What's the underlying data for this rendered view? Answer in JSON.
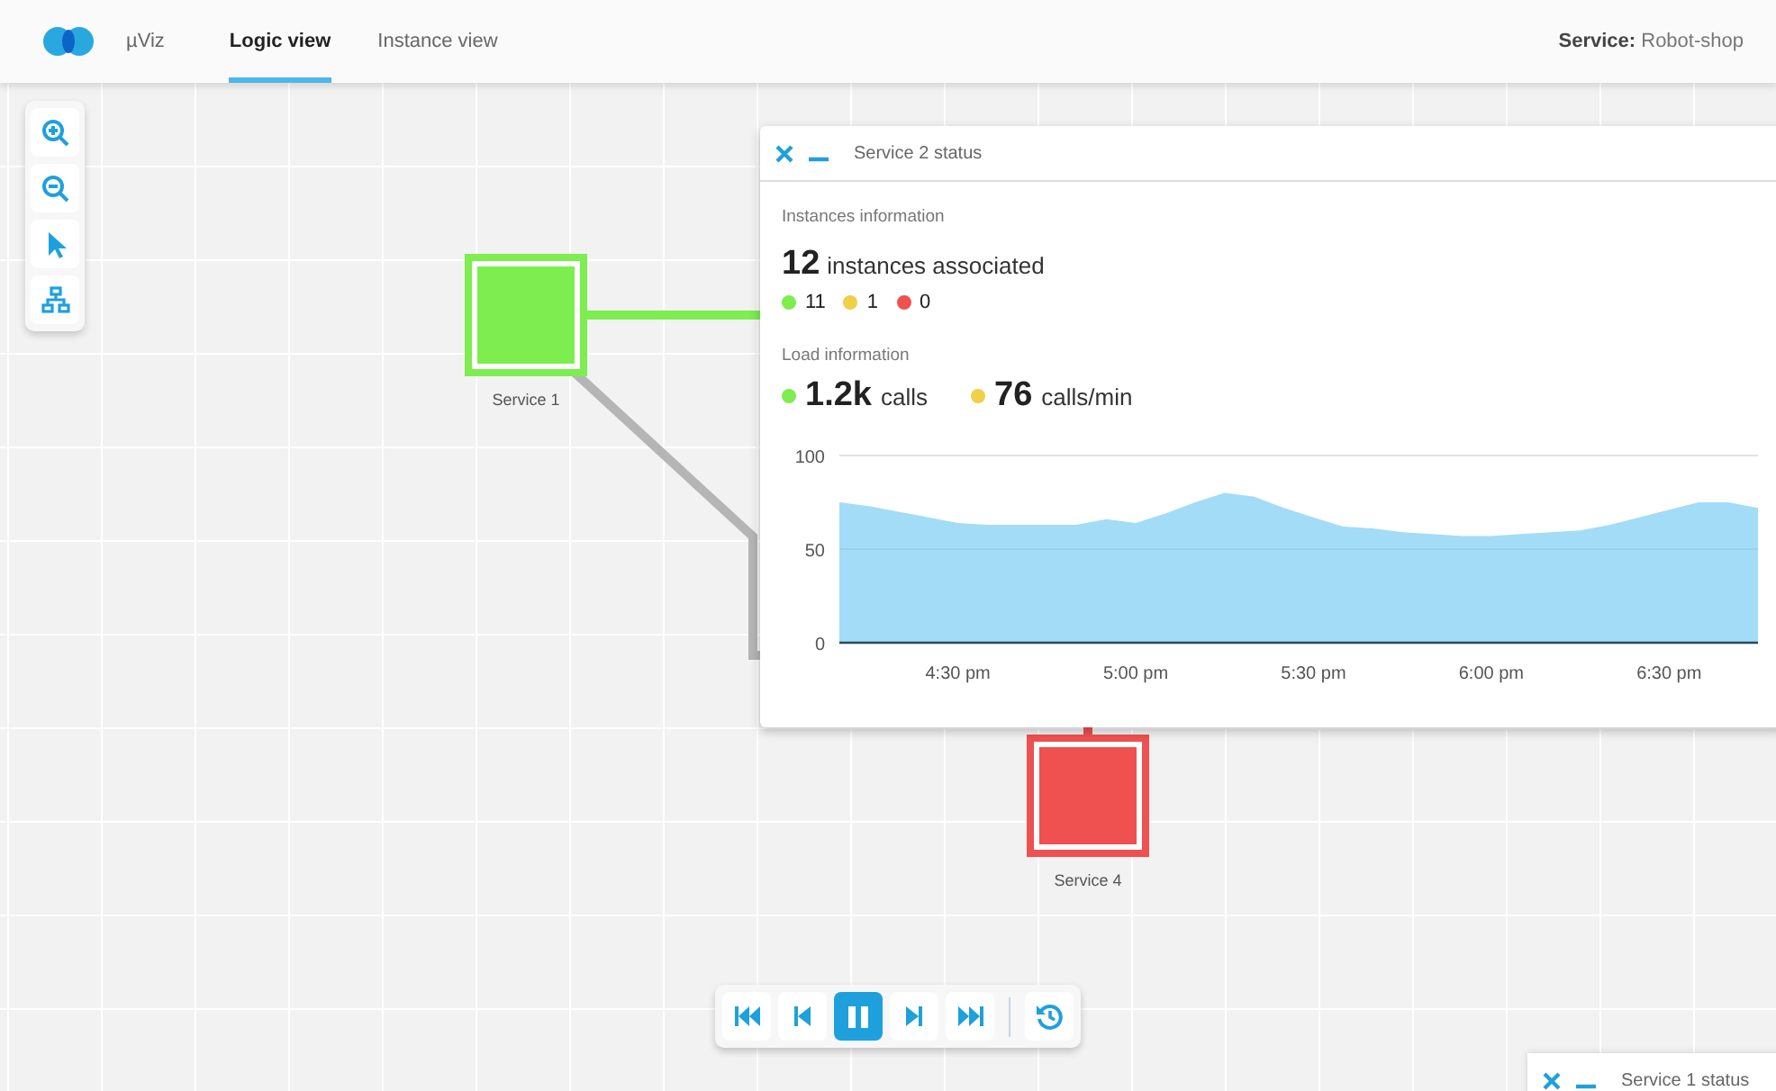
{
  "header": {
    "app_name": "µViz",
    "tabs": [
      {
        "label": "Logic view",
        "selected": true
      },
      {
        "label": "Instance view",
        "selected": false
      }
    ],
    "service_label": "Service:",
    "service_value": "Robot-shop"
  },
  "nodes": [
    {
      "name": "Service 1",
      "color": "#7ded4f"
    },
    {
      "name": "Service 4",
      "color": "#ef5050"
    }
  ],
  "status_panel": {
    "title": "Service 2 status",
    "instances_heading": "Instances information",
    "instances_count": "12",
    "instances_text": "instances associated",
    "instance_counts": [
      {
        "value": "11",
        "color": "#7ded4f"
      },
      {
        "value": "1",
        "color": "#f0cf4a"
      },
      {
        "value": "0",
        "color": "#ef5050"
      }
    ],
    "load_heading": "Load information",
    "load_stats": [
      {
        "value": "1.2k",
        "unit": "calls",
        "color": "#7ded4f"
      },
      {
        "value": "76",
        "unit": "calls/min",
        "color": "#f0cf4a"
      }
    ],
    "chart_data": {
      "type": "area",
      "categories": [
        null,
        null,
        null,
        null,
        "4:30 pm",
        null,
        null,
        null,
        null,
        null,
        "5:00 pm",
        null,
        null,
        null,
        null,
        null,
        "5:30 pm",
        null,
        null,
        null,
        null,
        null,
        "6:00 pm",
        null,
        null,
        null,
        null,
        null,
        "6:30 pm",
        null,
        null,
        null
      ],
      "series": [
        {
          "color": "#a3dcf6",
          "values": [
            75,
            73,
            70,
            67,
            64,
            63,
            63,
            63,
            63,
            66,
            64,
            69,
            75,
            80,
            78,
            72,
            67,
            62,
            61,
            59,
            58,
            57,
            57,
            58,
            59,
            60,
            63,
            67,
            71,
            75,
            75,
            72
          ]
        }
      ],
      "ylim": [
        0,
        100
      ],
      "yticks": [
        0,
        50,
        100
      ]
    }
  },
  "playback": {
    "buttons": [
      {
        "kind": "first",
        "selected": false
      },
      {
        "kind": "prev",
        "selected": false
      },
      {
        "kind": "pause",
        "selected": true
      },
      {
        "kind": "next",
        "selected": false
      },
      {
        "kind": "last",
        "selected": false
      },
      {
        "kind": "history",
        "selected": false
      }
    ]
  },
  "minimized_panel": {
    "title": "Service 1 status"
  }
}
